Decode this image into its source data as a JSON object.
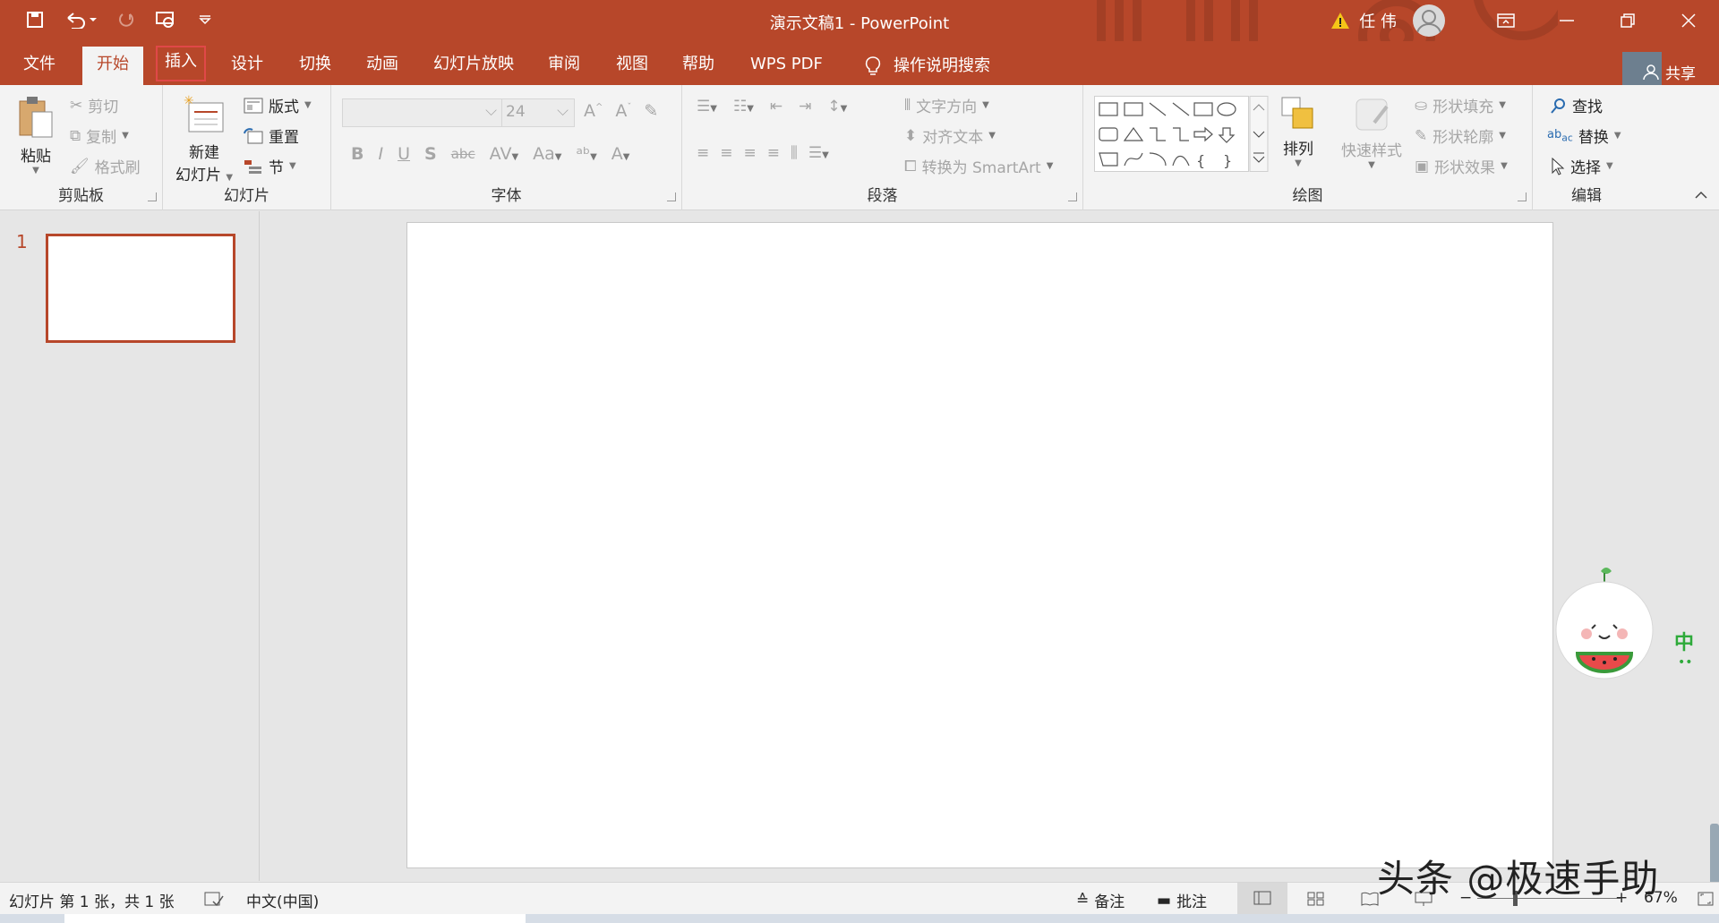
{
  "titlebar": {
    "title": "演示文稿1  -  PowerPoint",
    "user_name": "任 伟",
    "qat": [
      "save-icon",
      "undo-icon",
      "redo-icon",
      "present-from-start-icon",
      "customize-qat-icon"
    ]
  },
  "tabs": [
    {
      "label": "文件"
    },
    {
      "label": "开始"
    },
    {
      "label": "插入"
    },
    {
      "label": "设计"
    },
    {
      "label": "切换"
    },
    {
      "label": "动画"
    },
    {
      "label": "幻灯片放映"
    },
    {
      "label": "审阅"
    },
    {
      "label": "视图"
    },
    {
      "label": "帮助"
    },
    {
      "label": "WPS PDF"
    },
    {
      "label": "操作说明搜索"
    }
  ],
  "share_label": "共享",
  "ribbon": {
    "clipboard": {
      "label": "剪贴板",
      "paste": "粘贴",
      "cut": "剪切",
      "copy": "复制",
      "format_painter": "格式刷"
    },
    "slides": {
      "label": "幻灯片",
      "new_slide_1": "新建",
      "new_slide_2": "幻灯片",
      "layout": "版式",
      "reset": "重置",
      "section": "节"
    },
    "font": {
      "label": "字体",
      "font_size": "24",
      "bold": "B",
      "italic": "I",
      "underline": "U",
      "shadow": "S",
      "strike": "abc",
      "spacing": "AV",
      "case": "Aa",
      "color": "A"
    },
    "paragraph": {
      "label": "段落",
      "text_direction": "文字方向",
      "align_text": "对齐文本",
      "smartart": "转换为 SmartArt"
    },
    "drawing": {
      "label": "绘图",
      "arrange": "排列",
      "quick_styles": "快速样式",
      "shape_fill": "形状填充",
      "shape_outline": "形状轮廓",
      "shape_effects": "形状效果"
    },
    "editing": {
      "label": "编辑",
      "find": "查找",
      "replace": "替换",
      "select": "选择"
    }
  },
  "thumbnails": [
    {
      "number": "1"
    }
  ],
  "statusbar": {
    "slide_info": "幻灯片 第 1 张，共 1 张",
    "language": "中文(中国)",
    "notes": "备注",
    "comments": "批注",
    "zoom": "67%"
  },
  "overlay": {
    "watermark": "头条 @极速手助",
    "ime_label": "中"
  },
  "colors": {
    "accent": "#b7472a",
    "highlight_box": "#e04848"
  }
}
